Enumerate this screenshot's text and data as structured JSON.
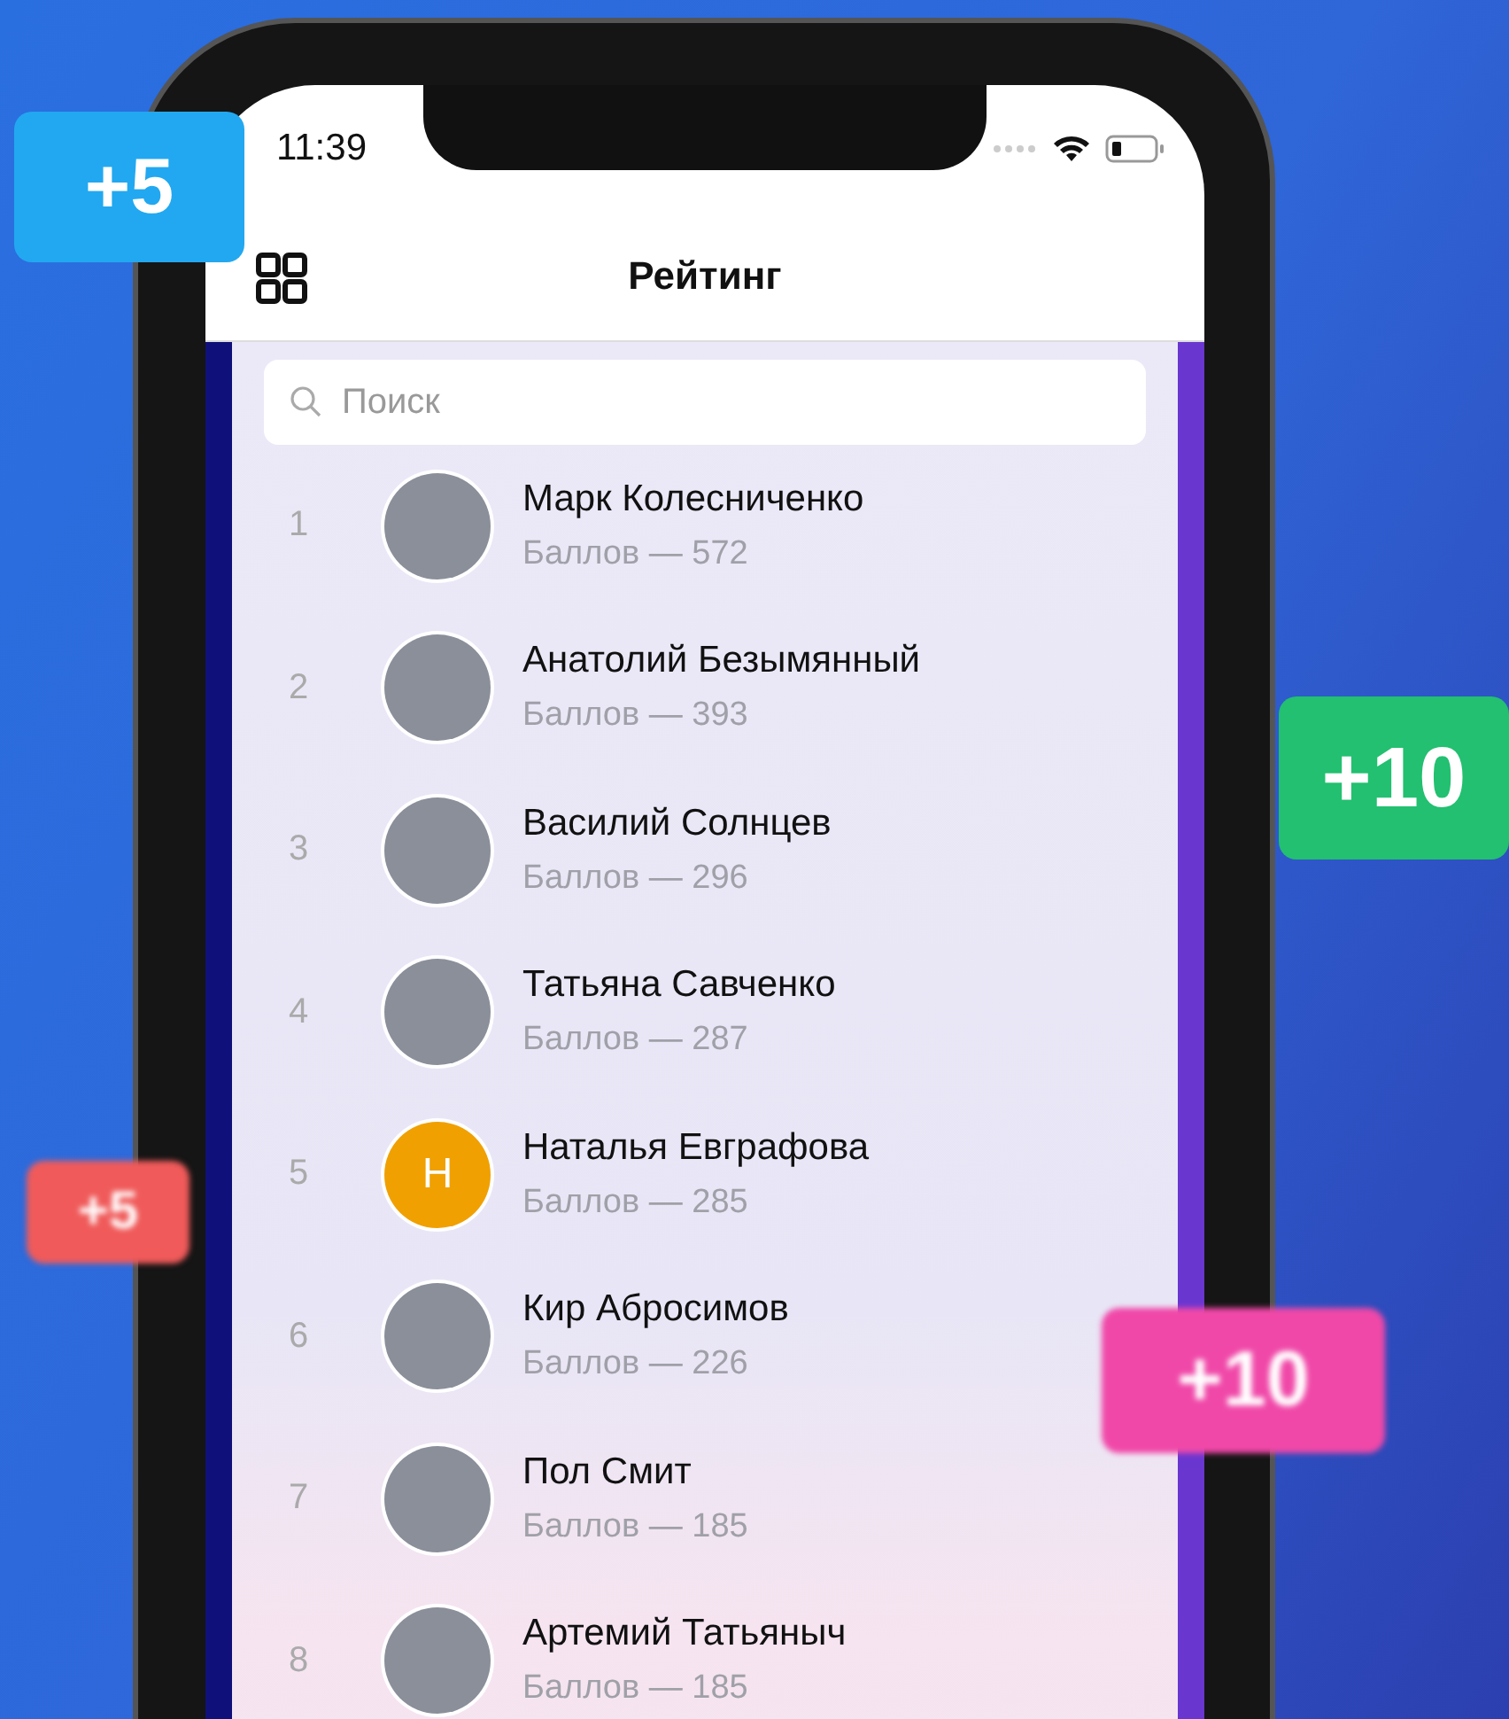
{
  "status_bar": {
    "time": "11:39"
  },
  "header": {
    "title": "Рейтинг"
  },
  "search": {
    "placeholder": "Поиск"
  },
  "rating": [
    {
      "rank": "1",
      "name": "Марк Колесниченко",
      "score": "Баллов — 572",
      "avatar": {
        "kind": "photo"
      }
    },
    {
      "rank": "2",
      "name": "Анатолий Безымянный",
      "score": "Баллов — 393",
      "avatar": {
        "kind": "photo"
      }
    },
    {
      "rank": "3",
      "name": "Василий Солнцев",
      "score": "Баллов — 296",
      "avatar": {
        "kind": "photo"
      }
    },
    {
      "rank": "4",
      "name": "Татьяна Савченко",
      "score": "Баллов — 287",
      "avatar": {
        "kind": "photo"
      }
    },
    {
      "rank": "5",
      "name": "Наталья Евграфова",
      "score": "Баллов — 285",
      "avatar": {
        "kind": "letter",
        "letter": "Н",
        "color": "#f0a000"
      }
    },
    {
      "rank": "6",
      "name": "Кир Абросимов",
      "score": "Баллов — 226",
      "avatar": {
        "kind": "photo"
      }
    },
    {
      "rank": "7",
      "name": "Пол Смит",
      "score": "Баллов — 185",
      "avatar": {
        "kind": "photo"
      }
    },
    {
      "rank": "8",
      "name": "Артемий Татьяныч",
      "score": "Баллов — 185",
      "avatar": {
        "kind": "photo"
      }
    }
  ],
  "floating_badges": [
    {
      "text": "+5",
      "color": "#22a8f0",
      "blurred": false
    },
    {
      "text": "+10",
      "color": "#22c070",
      "blurred": false
    },
    {
      "text": "+5",
      "color": "#f05a5a",
      "blurred": true
    },
    {
      "text": "+10",
      "color": "#f048a8",
      "blurred": true
    }
  ]
}
